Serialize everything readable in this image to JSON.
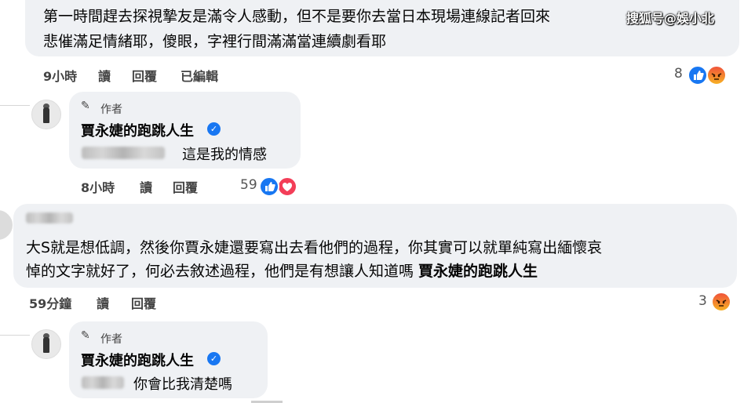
{
  "watermark": "搜狐号@娛小北",
  "comment1": {
    "line1": "第一時間趕去探視摯友是滿令人感動，但不是要你去當日本現場連線記者回來",
    "line2": "悲催滿足情緒耶，傻眼，字裡行間滿滿當連續劇看耶",
    "time": "9小時",
    "read": "讀",
    "reply": "回覆",
    "edited": "已編輯",
    "reaction_count": "8",
    "reactions": [
      "like-icon",
      "angry-icon"
    ]
  },
  "reply1": {
    "badge": "作者",
    "author": "賈永婕的跑跳人生",
    "text": "這是我的情感",
    "time": "8小時",
    "read": "讀",
    "reply": "回覆",
    "reaction_count": "59",
    "reactions": [
      "like-icon",
      "love-icon"
    ]
  },
  "comment2": {
    "line1": "大S就是想低調，然後你賈永婕還要寫出去看他們的過程，你其實可以就單純寫出緬懷哀",
    "line2_prefix": "悼的文字就好了，何必去敘述過程，他們是有想讓人知道嗎 ",
    "line2_mention": "賈永婕的跑跳人生",
    "time": "59分鐘",
    "read": "讀",
    "reply": "回覆",
    "reaction_count": "3",
    "reactions": [
      "angry-icon"
    ]
  },
  "reply2": {
    "badge": "作者",
    "author": "賈永婕的跑跳人生",
    "text": "你會比我清楚嗎"
  },
  "colors": {
    "bubble": "#eff1f4",
    "like": "#1877f2",
    "love": "#f33e58",
    "angry": "#f0533a",
    "verified": "#1877f2"
  }
}
